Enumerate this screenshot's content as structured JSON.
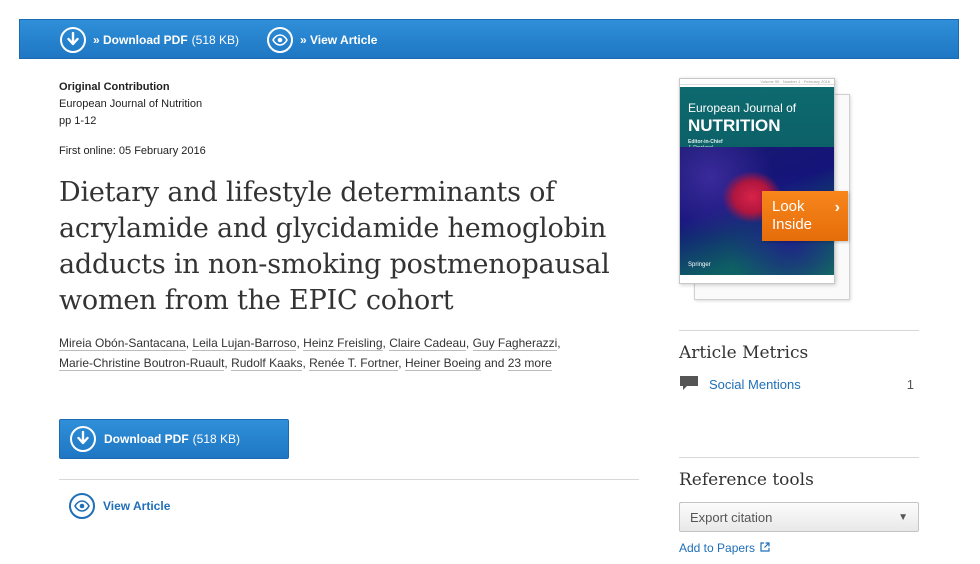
{
  "topbar": {
    "download_label": "» Download PDF",
    "download_size": "(518 KB)",
    "view_label": "» View Article"
  },
  "meta": {
    "contribution_type": "Original Contribution",
    "journal": "European Journal of Nutrition",
    "pages": "pp 1-12",
    "first_online": "First online: 05 February 2016"
  },
  "article": {
    "title": "Dietary and lifestyle determinants of acrylamide and glycidamide hemoglobin adducts in non-smoking postmenopausal women from the EPIC cohort",
    "authors": [
      "Mireia Obón-Santacana",
      "Leila Lujan-Barroso",
      "Heinz Freisling",
      "Claire Cadeau",
      "Guy Fagherazzi",
      "Marie-Christine Boutron-Ruault",
      "Rudolf Kaaks",
      "Renée T. Fortner",
      "Heiner Boeing"
    ],
    "and_text": "and",
    "more_authors": "23 more"
  },
  "download_button": {
    "label": "Download PDF",
    "size": "(518 KB)"
  },
  "view_article": {
    "label": "View Article"
  },
  "cover": {
    "header_strip": "Volume 55 · Number 1 · February 2016",
    "title_line1": "European Journal of",
    "title_line2": "NUTRITION",
    "editor_label": "Editor-in-Chief",
    "editor_name": "J. Rowland",
    "publisher": "Springer",
    "look_inside": "Look Inside"
  },
  "metrics": {
    "title": "Article Metrics",
    "items": [
      {
        "label": "Social Mentions",
        "count": "1"
      }
    ]
  },
  "reference_tools": {
    "title": "Reference tools",
    "export_label": "Export citation",
    "add_to_papers": "Add to Papers"
  },
  "colors": {
    "primary_blue": "#1f77c4",
    "link_blue": "#1f6fb8",
    "accent_orange": "#f07a12"
  }
}
